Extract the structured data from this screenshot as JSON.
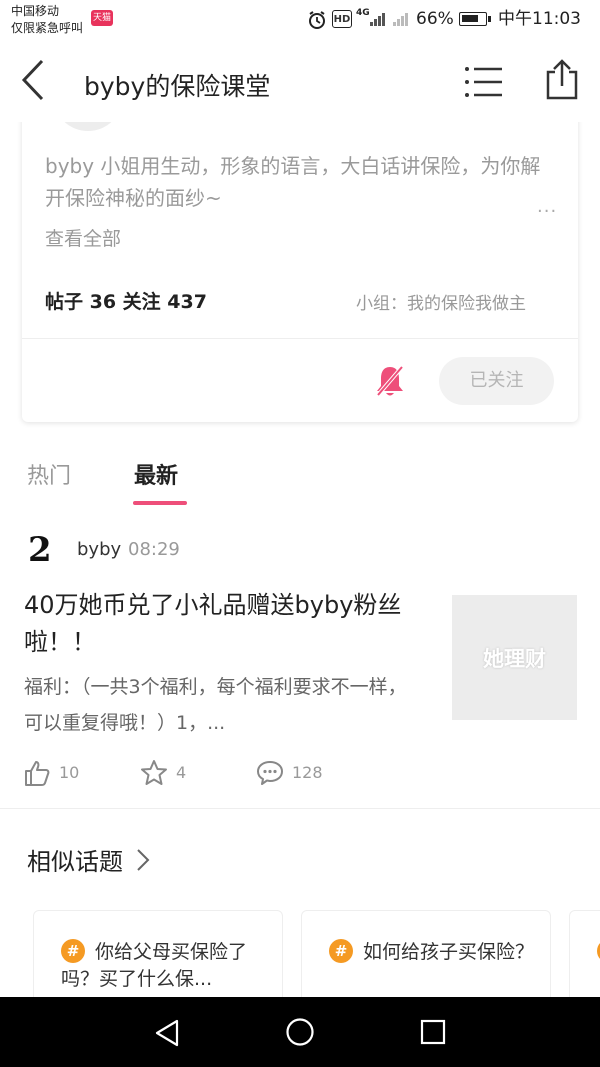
{
  "status_bar": {
    "carrier_line1": "中国移动",
    "carrier_line2": "仅限紧急呼叫",
    "tmall_badge": "天猫",
    "hd": "HD",
    "network": "4G",
    "battery_pct": "66%",
    "time": "中午11:03"
  },
  "header": {
    "title": "byby的保险课堂",
    "back_icon": "back-chevron-icon",
    "menu_icon": "list-menu-icon",
    "share_icon": "share-icon"
  },
  "profile_card": {
    "description": "byby 小姐用生动，形象的语言，大白话讲保险，为你解开保险神秘的面纱~",
    "more": "...",
    "see_all": "查看全部",
    "stats": "帖子 36  关注 437",
    "group": "小组：我的保险我做主",
    "mute_icon": "bell-off-icon",
    "follow_label": "已关注"
  },
  "tabs": [
    {
      "label": "热门",
      "active": false
    },
    {
      "label": "最新",
      "active": true
    }
  ],
  "post": {
    "author": "byby",
    "time": "08:29",
    "avatar_glyph": "2",
    "title": "40万她币兑了小礼品赠送byby粉丝啦！！",
    "excerpt": "福利：（一共3个福利，每个福利要求不一样，可以重复得哦！）1，...",
    "thumb_text": "她理财",
    "likes": "10",
    "favorites": "4",
    "comments": "128"
  },
  "similar": {
    "title": "相似话题",
    "topics": [
      {
        "text": "你给父母买保险了吗？买了什么保..."
      },
      {
        "text": "如何给孩子买保险？"
      }
    ]
  },
  "colors": {
    "accent": "#ee4f7a",
    "hash_badge": "#f59a23",
    "nav_bar": "#000000"
  }
}
